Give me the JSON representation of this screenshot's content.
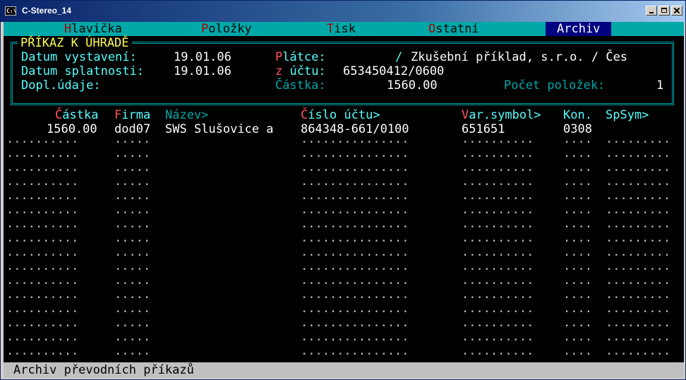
{
  "window": {
    "title": "C-Stereo_14",
    "icon": "console-icon",
    "icon_text": "C:\\"
  },
  "menu": {
    "items": [
      {
        "hot": "H",
        "rest": "lavička"
      },
      {
        "hot": "P",
        "rest": "oložky"
      },
      {
        "hot": "T",
        "rest": "isk"
      },
      {
        "hot": "O",
        "rest": "statní"
      },
      {
        "hot": "",
        "rest": "Archiv"
      }
    ]
  },
  "header": {
    "title": "PŘÍKAZ K ÚHRADĚ",
    "datum_vystaveni_label": "Datum vystavení:",
    "datum_vystaveni": "19.01.06",
    "datum_splatnosti_label": "Datum splatnosti:",
    "datum_splatnosti": "19.01.06",
    "dopl_udaje_label": "Dopl.údaje:",
    "platce_hot": "P",
    "platce_rest": "látce:",
    "platce_sep": "/",
    "platce_value": "Zkušební příklad, s.r.o. / Čes",
    "z_uctu_hot": "z",
    "z_uctu_rest": " účtu:",
    "z_uctu_value": "653450412/0600",
    "castka_label": "Částka:",
    "castka_value": "1560.00",
    "pocet_label": "Počet položek:",
    "pocet_value": "1"
  },
  "table": {
    "columns": [
      {
        "hot": "Č",
        "rest": "ástka",
        "color": "hot"
      },
      {
        "hot": "F",
        "rest": "irma",
        "color": "hot"
      },
      {
        "hot": "",
        "rest": "Název>",
        "color": "dim"
      },
      {
        "hot": "Č",
        "rest": "íslo účtu>",
        "color": "hot"
      },
      {
        "hot": "V",
        "rest": "ar.symbol>",
        "color": "hot"
      },
      {
        "hot": "",
        "rest": "Kon.",
        "color": "cyan"
      },
      {
        "hot": "",
        "rest": "SpSym>",
        "color": "cyan"
      }
    ],
    "rows": [
      {
        "castka": "1560.00",
        "firma": "dod07",
        "nazev": "SWS Slušovice a",
        "cislo_uctu": "864348-661/0100",
        "var_symbol": "651651",
        "kon": "0308",
        "spsym": ""
      }
    ],
    "empty_row_count": 16
  },
  "status": {
    "text": "Archiv převodních příkazů"
  }
}
